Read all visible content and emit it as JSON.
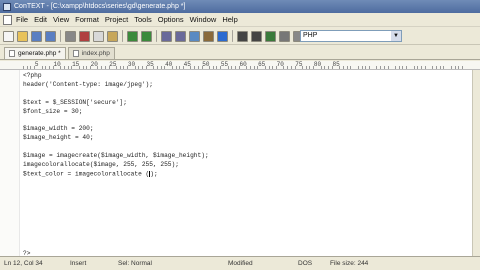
{
  "window": {
    "title": "ConTEXT - [C:\\xampp\\htdocs\\series\\gd\\generate.php *]"
  },
  "menu": [
    "File",
    "Edit",
    "View",
    "Format",
    "Project",
    "Tools",
    "Options",
    "Window",
    "Help"
  ],
  "toolbar": {
    "icons": [
      "new-file-icon",
      "open-folder-icon",
      "save-icon",
      "save-all-icon",
      "print-icon",
      "cut-icon",
      "copy-icon",
      "paste-icon",
      "undo-icon",
      "redo-icon",
      "find-icon",
      "find-next-icon",
      "replace-icon",
      "goto-icon",
      "bookmark-icon",
      "indent-icon",
      "unindent-icon",
      "comment-icon",
      "word-wrap-icon",
      "settings-icon",
      "help-icon"
    ],
    "highlighter": "PHP"
  },
  "tabs": [
    {
      "label": "generate.php *",
      "active": true
    },
    {
      "label": "index.php",
      "active": false
    }
  ],
  "ruler": [
    "5",
    "10",
    "15",
    "20",
    "25",
    "30",
    "35",
    "40",
    "45",
    "50",
    "55",
    "60",
    "65",
    "70",
    "75",
    "80",
    "85"
  ],
  "code_lines": [
    "<?php",
    "header('Content-type: image/jpeg');",
    "",
    "$text = $_SESSION['secure'];",
    "$font_size = 30;",
    "",
    "$image_width = 200;",
    "$image_height = 40;",
    "",
    "$image = imagecreate($image_width, $image_height);",
    "imagecolorallocate($image, 255, 255, 255);",
    "$text_color = imagecolorallocate (",
    "",
    "",
    "",
    "",
    "",
    "",
    "",
    "",
    "?>"
  ],
  "caret_line": 11,
  "caret_after": ");",
  "status": {
    "position": "Ln 12, Col 34",
    "mode": "Insert",
    "selection": "Sel: Normal",
    "modified": "Modified",
    "format": "DOS",
    "file_size": "File size: 244"
  }
}
